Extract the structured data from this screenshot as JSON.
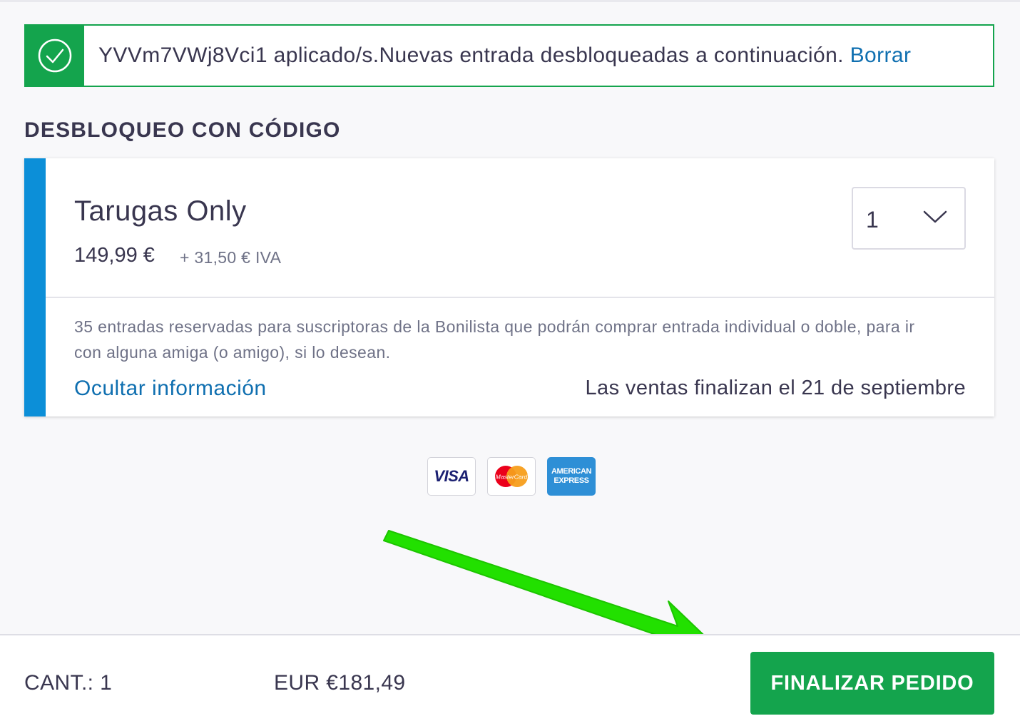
{
  "banner": {
    "message": "YVVm7VWj8Vci1 aplicado/s.Nuevas entrada desbloqueadas a continuación.",
    "clear_link": "Borrar",
    "icon": "check-circle-icon"
  },
  "section": {
    "title": "DESBLOQUEO CON CÓDIGO"
  },
  "ticket": {
    "name": "Tarugas Only",
    "price": "149,99 €",
    "tax": "+ 31,50 € IVA",
    "quantity": "1",
    "description": "35 entradas reservadas para suscriptoras de la Bonilista que podrán comprar entrada individual o doble, para ir con alguna amiga (o amigo), si lo desean.",
    "hide_info_link": "Ocultar información",
    "sales_end": "Las ventas finalizan el 21 de septiembre"
  },
  "payments": {
    "visa": "VISA",
    "mastercard": "MasterCard",
    "amex_line1": "AMERICAN",
    "amex_line2": "EXPRESS"
  },
  "footer": {
    "quantity": "CANT.: 1",
    "total": "EUR €181,49",
    "checkout_button": "FINALIZAR PEDIDO"
  },
  "colors": {
    "success_green": "#14a44d",
    "link_blue": "#0f6fb0",
    "accent_blue": "#0c8fd8",
    "arrow_green": "#22e000"
  }
}
